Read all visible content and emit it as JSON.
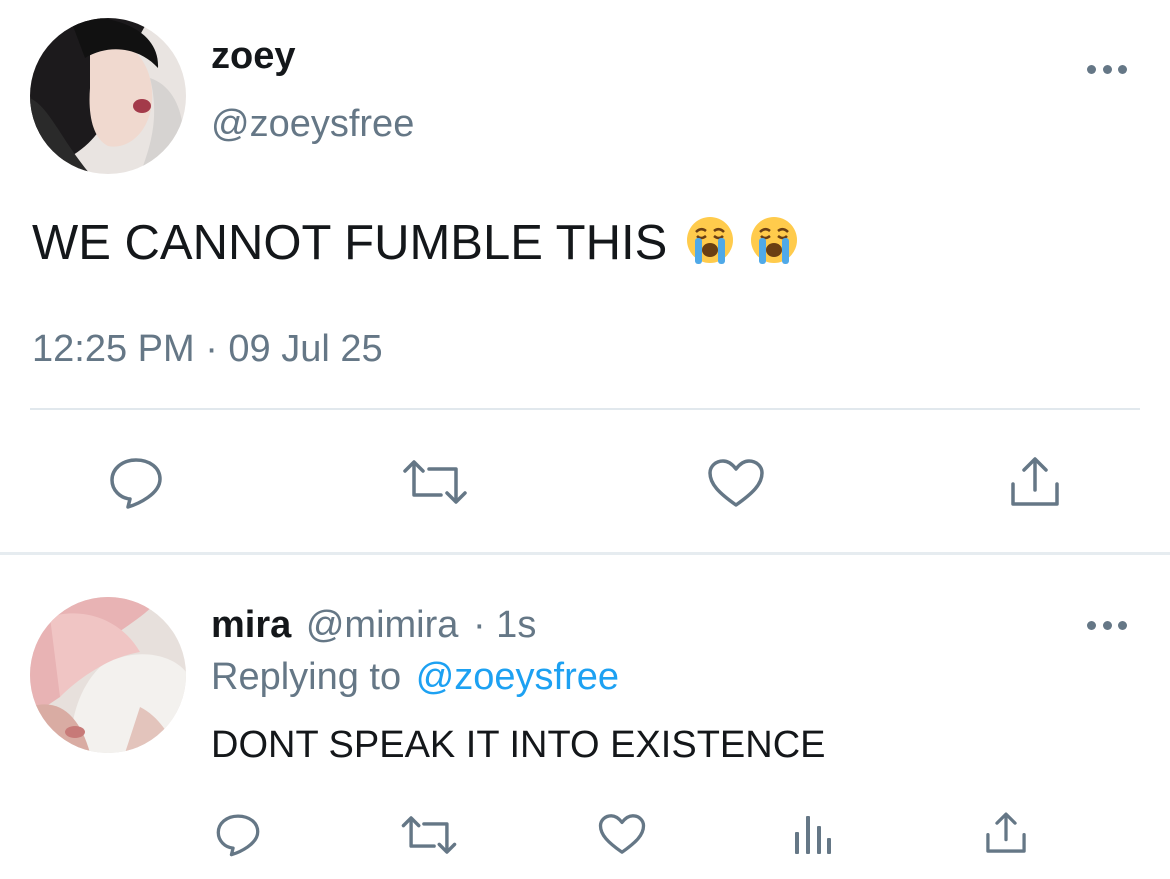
{
  "tweet": {
    "author": {
      "display_name": "zoey",
      "handle": "@zoeysfree"
    },
    "text": "WE CANNOT FUMBLE THIS",
    "emoji": [
      "loudly-crying-face",
      "loudly-crying-face"
    ],
    "timestamp": "12:25 PM · 09 Jul 25",
    "actions": [
      "reply-icon",
      "retweet-icon",
      "like-icon",
      "share-icon"
    ]
  },
  "reply": {
    "author": {
      "display_name": "mira",
      "handle": "@mimira",
      "time": "· 1s"
    },
    "replying_prefix": "Replying to",
    "replying_to": "@zoeysfree",
    "text": "DONT SPEAK IT INTO EXISTENCE",
    "actions": [
      "reply-icon",
      "retweet-icon",
      "like-icon",
      "analytics-icon",
      "share-icon"
    ]
  },
  "colors": {
    "text": "#14171a",
    "muted": "#657786",
    "link": "#1da1f2",
    "divider": "#e1e8ed"
  }
}
